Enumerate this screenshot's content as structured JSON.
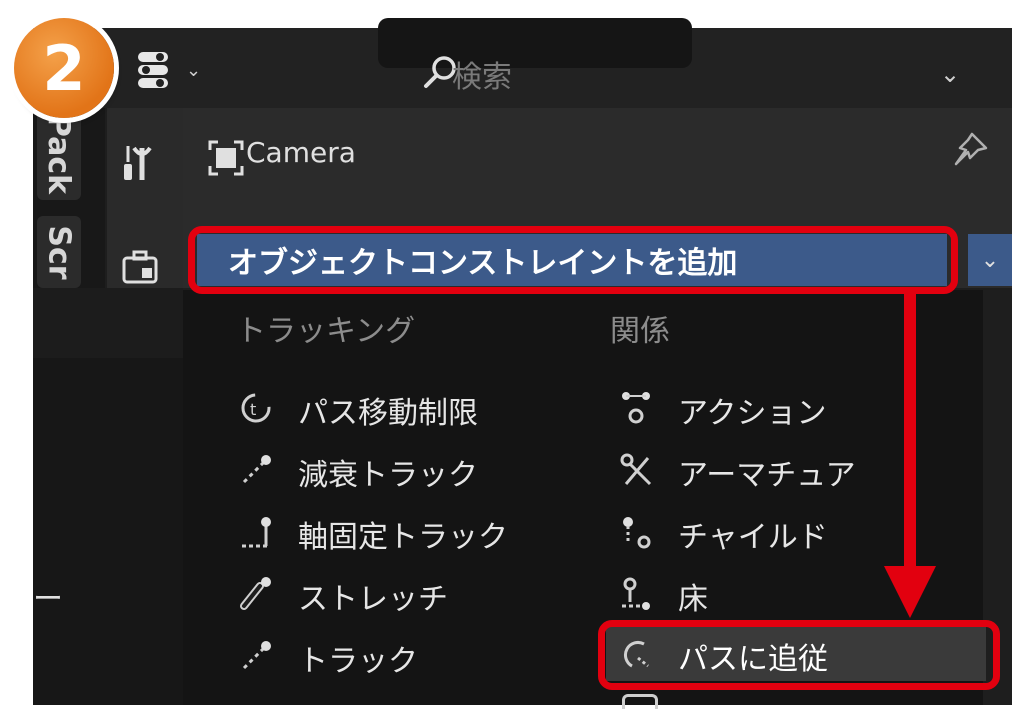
{
  "step_badge": "2",
  "header": {
    "search_placeholder": "検索",
    "icons": [
      "editor-type-icon",
      "search-icon",
      "chevron-down-icon"
    ]
  },
  "side_tabs": [
    {
      "label": "Pack"
    },
    {
      "label": "Scr"
    }
  ],
  "properties": {
    "object_name": "Camera",
    "add_constraint_label": "オブジェクトコンストレイントを追加"
  },
  "left_sidebar_fragment": "ー",
  "menu": {
    "columns": [
      {
        "heading": "トラッキング",
        "items": [
          {
            "label": "パス移動制限",
            "icon": "follow-path-clamp-icon"
          },
          {
            "label": "減衰トラック",
            "icon": "damped-track-icon"
          },
          {
            "label": "軸固定トラック",
            "icon": "locked-track-icon"
          },
          {
            "label": "ストレッチ",
            "icon": "stretch-to-icon"
          },
          {
            "label": "トラック",
            "icon": "track-to-icon"
          }
        ]
      },
      {
        "heading": "関係",
        "items": [
          {
            "label": "アクション",
            "icon": "action-icon"
          },
          {
            "label": "アーマチュア",
            "icon": "armature-icon"
          },
          {
            "label": "チャイルド",
            "icon": "child-of-icon"
          },
          {
            "label": "床",
            "icon": "floor-icon"
          },
          {
            "label": "パスに追従",
            "icon": "follow-path-icon",
            "highlighted": true
          }
        ]
      }
    ]
  },
  "colors": {
    "annotation_red": "#e2000f",
    "badge_orange": "#e27418",
    "dropdown_blue": "#3c5a8a",
    "panel_bg": "#1e1e1e"
  }
}
